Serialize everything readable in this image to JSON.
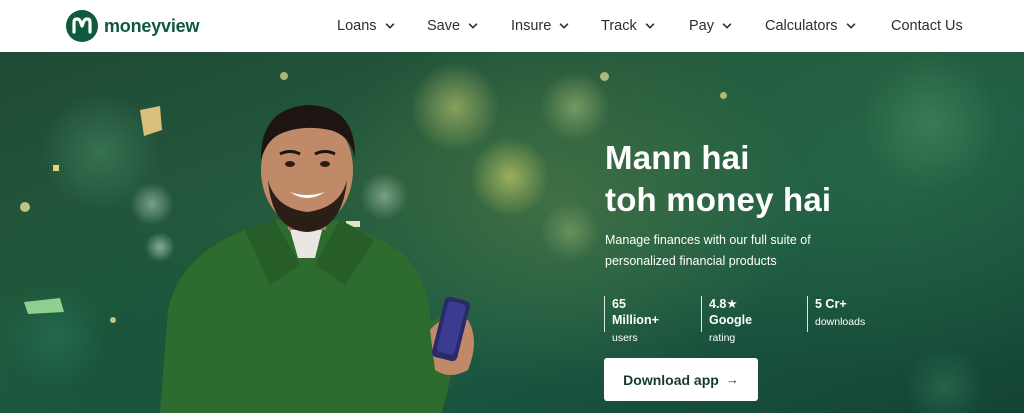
{
  "brand": {
    "name": "moneyview",
    "color": "#0f5a3c"
  },
  "nav": {
    "items": [
      {
        "label": "Loans",
        "has_dropdown": true
      },
      {
        "label": "Save",
        "has_dropdown": true
      },
      {
        "label": "Insure",
        "has_dropdown": true
      },
      {
        "label": "Track",
        "has_dropdown": true
      },
      {
        "label": "Pay",
        "has_dropdown": true
      },
      {
        "label": "Calculators",
        "has_dropdown": true
      },
      {
        "label": "Contact Us",
        "has_dropdown": false
      }
    ]
  },
  "hero": {
    "headline_line1": "Mann hai",
    "headline_line2": "toh money hai",
    "subtext": "Manage finances with our full suite of personalized financial products",
    "stats": [
      {
        "value": "65 Million+",
        "label": "users"
      },
      {
        "value": "4.8★ Google",
        "label": "rating"
      },
      {
        "value": "5 Cr+",
        "label": "downloads"
      }
    ],
    "cta_label": "Download app",
    "cta_icon": "arrow-right-icon",
    "background_color": "#245a3d"
  }
}
